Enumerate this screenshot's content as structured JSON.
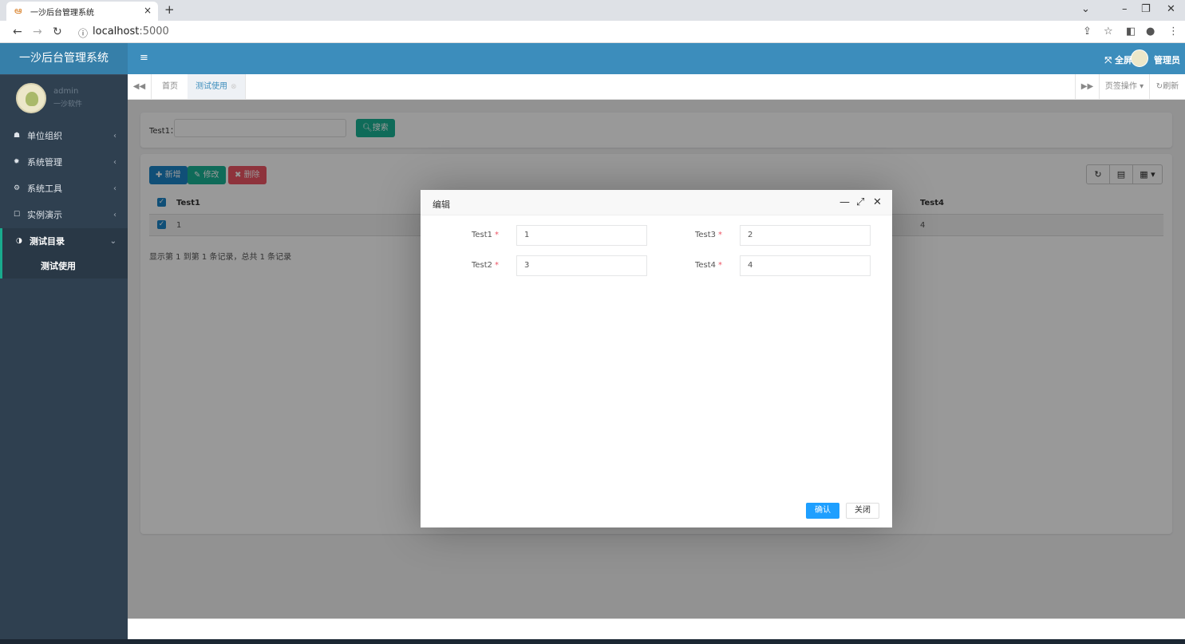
{
  "browser": {
    "tab_title": "一沙后台管理系统",
    "tab_close": "×",
    "new_tab": "+",
    "url_host": "localhost",
    "url_port": ":5000",
    "win_controls": [
      "⌄",
      "–",
      "❐",
      "✕"
    ]
  },
  "app": {
    "logo_text": "一沙后台管理系统",
    "user_name": "admin",
    "user_org": "一沙软件",
    "fullscreen_label": "全屏",
    "admin_label": "管理员"
  },
  "menu": [
    {
      "icon": "home-icon",
      "label": "单位组织",
      "chevron": "‹"
    },
    {
      "icon": "gear-icon",
      "label": "系统管理",
      "chevron": "‹"
    },
    {
      "icon": "cogs-icon",
      "label": "系统工具",
      "chevron": "‹"
    },
    {
      "icon": "square-icon",
      "label": "实例演示",
      "chevron": "‹"
    },
    {
      "icon": "half-circle-icon",
      "label": "测试目录",
      "chevron": "⌄"
    }
  ],
  "submenu": {
    "label": "测试使用"
  },
  "tabs": {
    "home": "首页",
    "active": "测试使用",
    "page_ops": "页签操作",
    "refresh": "刷新"
  },
  "search": {
    "label": "Test1：",
    "value": "",
    "button": "搜索"
  },
  "toolbar": {
    "add": "新增",
    "edit": "修改",
    "delete": "删除"
  },
  "table": {
    "headers": [
      "Test1",
      "Test4"
    ],
    "rows": [
      {
        "test1": "1",
        "test4": "4"
      }
    ],
    "pager_text": "显示第 1 到第 1 条记录，总共 1 条记录"
  },
  "modal": {
    "title": "编辑",
    "fields": [
      {
        "label": "Test1",
        "value": "1"
      },
      {
        "label": "Test3",
        "value": "2"
      },
      {
        "label": "Test2",
        "value": "3"
      },
      {
        "label": "Test4",
        "value": "4"
      }
    ],
    "required_mark": "*",
    "confirm": "确认",
    "close": "关闭"
  },
  "colors": {
    "header": "#3c8dbc",
    "sidebar": "#2f4050",
    "primary": "#1c84c6",
    "success": "#1ab394",
    "danger": "#ed5565",
    "confirm": "#1e9fff"
  }
}
